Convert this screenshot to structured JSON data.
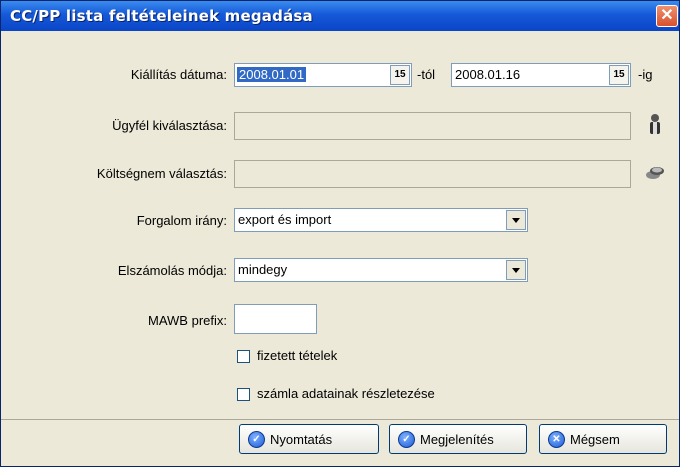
{
  "window": {
    "title": "CC/PP lista feltételeinek megadása",
    "close_symbol": "✕"
  },
  "form": {
    "date_label": "Kiállítás dátuma:",
    "date_from": "2008.01.01",
    "from_suffix": "-tól",
    "date_to": "2008.01.16",
    "to_suffix": "-ig",
    "calendar_icon": "15",
    "client_label": "Ügyfél kiválasztása:",
    "client_value": "",
    "costcenter_label": "Költségnem választás:",
    "costcenter_value": "",
    "direction_label": "Forgalom irány:",
    "direction_value": "export és import",
    "settlement_label": "Elszámolás módja:",
    "settlement_value": "mindegy",
    "mawb_label": "MAWB prefix:",
    "mawb_value": "",
    "paid_items_label": "fizetett tételek",
    "paid_items_checked": false,
    "invoice_details_label": "számla adatainak részletezése",
    "invoice_details_checked": false
  },
  "buttons": {
    "print": "Nyomtatás",
    "show": "Megjelenítés",
    "cancel": "Mégsem"
  },
  "icons": {
    "client_icon": "person-icon",
    "costcenter_icon": "coins-icon"
  }
}
